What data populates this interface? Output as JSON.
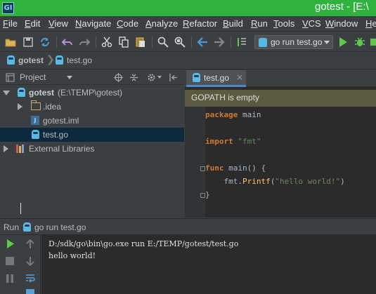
{
  "window": {
    "title": "gotest - [E:\\"
  },
  "menu": [
    "File",
    "Edit",
    "View",
    "Navigate",
    "Code",
    "Analyze",
    "Refactor",
    "Build",
    "Run",
    "Tools",
    "VCS",
    "Window",
    "He"
  ],
  "toolbar": {
    "run_config": "go run test.go"
  },
  "breadcrumb": [
    "gotest",
    "test.go"
  ],
  "project": {
    "header": "Project",
    "tree": [
      {
        "label": "gotest",
        "detail": "(E:\\TEMP\\gotest)"
      },
      {
        "label": ".idea"
      },
      {
        "label": "gotest.iml"
      },
      {
        "label": "test.go"
      },
      {
        "label": "External Libraries"
      }
    ]
  },
  "editor": {
    "tab": "test.go",
    "banner": "GOPATH is empty",
    "code": {
      "kw_package": "package",
      "pkg_name": " main",
      "kw_import": "import",
      "import_path": " \"fmt\"",
      "kw_func": "func",
      "func_sig": " main() {",
      "call_obj": "    fmt.",
      "call_fn": "Printf",
      "call_open": "(",
      "call_str": "\"hello world!\"",
      "call_close": ")",
      "close_brace": "}"
    }
  },
  "run": {
    "label": "Run",
    "config": "go run test.go",
    "console": [
      "D:/sdk/go\\bin\\go.exe run E:/TEMP/gotest/test.go",
      "hello world!"
    ]
  },
  "colors": {
    "title_bar": "#2fb33e",
    "selection": "#0d293e",
    "banner": "#5a5a3f",
    "keyword": "#cc7832",
    "string": "#6a8759",
    "function": "#ffc66d",
    "run_green": "#5ec94a"
  }
}
